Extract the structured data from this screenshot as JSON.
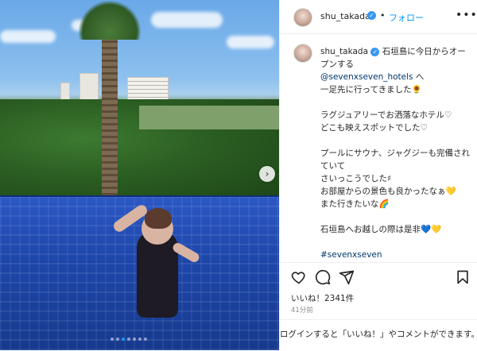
{
  "header": {
    "username": "shu_takada",
    "verified_icon": "check",
    "separator": "•",
    "follow_label": "フォロー",
    "more_icon": "•••"
  },
  "caption": {
    "username": "shu_takada",
    "line1": "石垣島に今日からオープンする",
    "mention": "@sevenxseven_hotels",
    "line2": " へ\n一足先に行ってきました🌻\n\nラグジュアリーでお洒落なホテル♡\nどこも映えスポットでした♡\n\nプールにサウナ、ジャグジーも完備されていて\nさいっこうでした♯\nお部屋からの景色も良かったなぁ💛\nまた行きたいな🌈\n\n石垣島へお越しの際は是非💙💛\n\n",
    "hashtags": "#sevenxseven\n#sevenxsevenishigaki\n#ishigaki\n#セブンバイセブン\n#セブンバイセブン石垣"
  },
  "actions": {
    "like_icon": "heart-outline",
    "comment_icon": "comment-bubble",
    "share_icon": "paper-plane",
    "save_icon": "bookmark"
  },
  "likes_text": "いいね！2341件",
  "time_text": "41分前",
  "login_text": "ログインすると「いいね！」やコメントができます。",
  "carousel": {
    "next_icon": "›",
    "total_slides": 7,
    "active_slide": 3
  }
}
